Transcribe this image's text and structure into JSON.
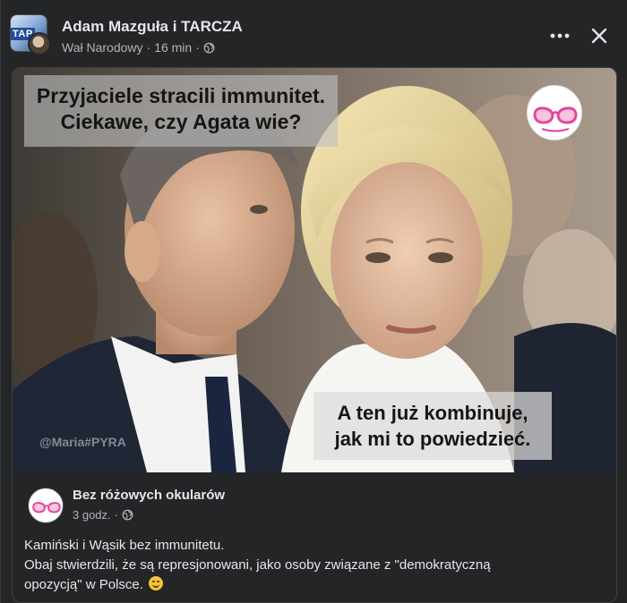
{
  "header": {
    "group_name": "Adam Mazguła i TARCZA",
    "subgroup": "Wał Narodowy",
    "separator": "·",
    "time": "16 min",
    "separator2": "·",
    "group_avatar_text": "TAP",
    "icons": {
      "privacy": "globe-icon",
      "more": "more-options-icon",
      "close": "close-icon"
    }
  },
  "shared": {
    "meme": {
      "caption_top_line1": "Przyjaciele stracili immunitet.",
      "caption_top_line2": "Ciekawe, czy Agata wie?",
      "caption_bottom_line1": "A ten już kombinuje,",
      "caption_bottom_line2": "jak mi to powiedzieć.",
      "watermark": "@Maria#PYRA",
      "badge_text": "Bez różowych okularów"
    },
    "page_name": "Bez różowych okularów",
    "time": "3 godz.",
    "separator": "·",
    "text_lines": [
      "Kamiński i Wąsik bez immunitetu.",
      "Obaj stwierdzili, że są represjonowani,  jako osoby związane z \"demokratyczną",
      "opozycją\" w Polsce."
    ],
    "emoji": "grinning-face-emoji"
  },
  "colors": {
    "background": "#242526",
    "text_primary": "#e4e6eb",
    "text_secondary": "#b0b3b8",
    "border": "#3e4042",
    "glasses_pink": "#e5449b"
  }
}
